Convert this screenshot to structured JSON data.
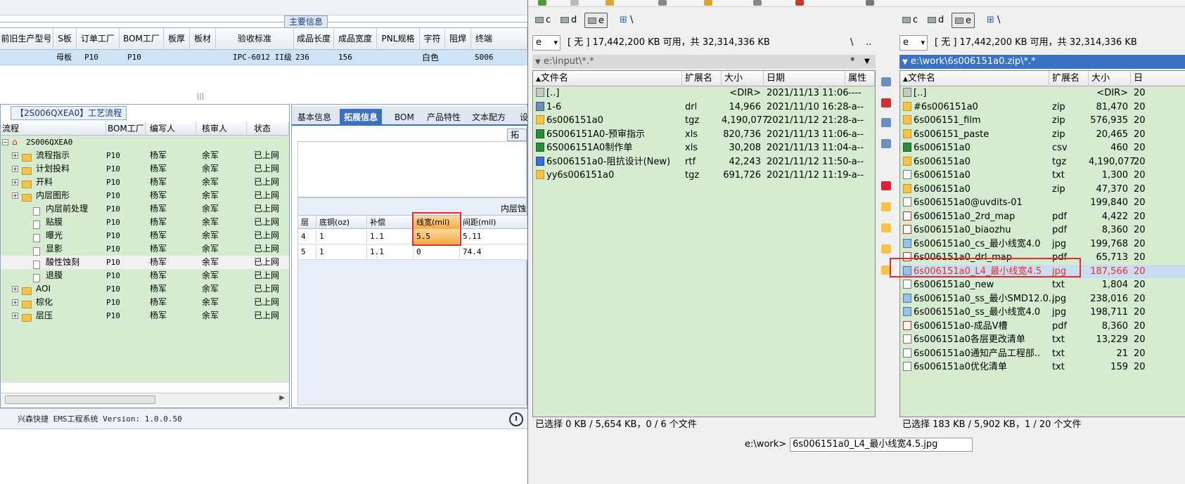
{
  "erp": {
    "main_info_title": "主要信息",
    "top_grid": {
      "columns": [
        "前旧生产型号",
        "S板",
        "订单工厂",
        "BOM工厂",
        "板厚",
        "板材",
        "验收标准",
        "成品长度",
        "成品宽度",
        "PNL规格",
        "字符",
        "阻焊",
        "终端"
      ],
      "row": [
        "",
        "母板",
        "P10",
        "P10",
        "",
        "",
        "IPC-6012 II级",
        "236",
        "156",
        "",
        "白色",
        "",
        "S006"
      ]
    },
    "splitter_grip": "|||",
    "tree": {
      "caption": "【2S006QXEA0】工艺流程",
      "columns": [
        "流程",
        "BOM工厂",
        "编写人",
        "核审人",
        "状态"
      ],
      "root": "2S006QXEA0",
      "rows": [
        {
          "name": "流程指示",
          "factory": "P10",
          "writer": "杨军",
          "reviewer": "余军",
          "status": "已上网",
          "level": 1,
          "type": "folder"
        },
        {
          "name": "计划投料",
          "factory": "P10",
          "writer": "杨军",
          "reviewer": "余军",
          "status": "已上网",
          "level": 1,
          "type": "folder"
        },
        {
          "name": "开料",
          "factory": "P10",
          "writer": "杨军",
          "reviewer": "余军",
          "status": "已上网",
          "level": 1,
          "type": "folder"
        },
        {
          "name": "内层图形",
          "factory": "P10",
          "writer": "杨军",
          "reviewer": "余军",
          "status": "已上网",
          "level": 1,
          "type": "folder"
        },
        {
          "name": "内层前处理",
          "factory": "P10",
          "writer": "杨军",
          "reviewer": "余军",
          "status": "已上网",
          "level": 2,
          "type": "file"
        },
        {
          "name": "贴膜",
          "factory": "P10",
          "writer": "杨军",
          "reviewer": "余军",
          "status": "已上网",
          "level": 2,
          "type": "file"
        },
        {
          "name": "曝光",
          "factory": "P10",
          "writer": "杨军",
          "reviewer": "余军",
          "status": "已上网",
          "level": 2,
          "type": "file"
        },
        {
          "name": "显影",
          "factory": "P10",
          "writer": "杨军",
          "reviewer": "余军",
          "status": "已上网",
          "level": 2,
          "type": "file"
        },
        {
          "name": "酸性蚀刻",
          "factory": "P10",
          "writer": "杨军",
          "reviewer": "余军",
          "status": "已上网",
          "level": 2,
          "type": "file"
        },
        {
          "name": "退膜",
          "factory": "P10",
          "writer": "杨军",
          "reviewer": "余军",
          "status": "已上网",
          "level": 2,
          "type": "file"
        },
        {
          "name": "AOI",
          "factory": "P10",
          "writer": "杨军",
          "reviewer": "余军",
          "status": "已上网",
          "level": 1,
          "type": "folder"
        },
        {
          "name": "棕化",
          "factory": "P10",
          "writer": "杨军",
          "reviewer": "余军",
          "status": "已上网",
          "level": 1,
          "type": "folder"
        },
        {
          "name": "层压",
          "factory": "P10",
          "writer": "杨军",
          "reviewer": "余军",
          "status": "已上网",
          "level": 1,
          "type": "folder"
        }
      ]
    },
    "detail": {
      "tabs": [
        "基本信息",
        "拓展信息",
        "BOM",
        "产品特性",
        "文本配方",
        "设"
      ],
      "active_tab": 1,
      "ext_button": "拓",
      "layer_title": "内层蚀",
      "layer_columns": [
        "层",
        "底铜(oz)",
        "补偿",
        "线宽(mil)",
        "间距(mil)"
      ],
      "layer_rows": [
        [
          "4",
          "1",
          "1.1",
          "5.5",
          "5.11"
        ],
        [
          "5",
          "1",
          "1.1",
          "0",
          "74.4"
        ]
      ]
    },
    "status_text": "兴森快捷 EMS工程系统 Version: 1.0.0.50"
  },
  "tc": {
    "left": {
      "drives": [
        "c",
        "d",
        "e"
      ],
      "active_drive": "e",
      "extra_button": "\\",
      "drive_select": "e",
      "info": "[ 无 ]  17,442,200 KB 可用，共 32,314,336 KB",
      "info_tail1": "\\",
      "info_tail2": "..",
      "path": "e:\\input\\*.*",
      "path_tail": "*",
      "columns": [
        "文件名",
        "扩展名",
        "大小",
        "日期",
        "属性"
      ],
      "files": [
        {
          "name": "[..]",
          "ext": "",
          "size": "<DIR>",
          "date": "2021/11/13 11:06",
          "attr": "----",
          "icon": "up"
        },
        {
          "name": "1-6",
          "ext": "drl",
          "size": "14,966",
          "date": "2021/11/10 16:28",
          "attr": "-a--",
          "icon": "lnk"
        },
        {
          "name": "6s006151a0",
          "ext": "tgz",
          "size": "4,190,077",
          "date": "2021/11/12 21:28",
          "attr": "-a--",
          "icon": "fold"
        },
        {
          "name": "6S006151A0-预审指示",
          "ext": "xls",
          "size": "820,736",
          "date": "2021/11/13 11:06",
          "attr": "-a--",
          "icon": "xls"
        },
        {
          "name": "6S006151A0制作单",
          "ext": "xls",
          "size": "30,208",
          "date": "2021/11/13 11:04",
          "attr": "-a--",
          "icon": "xls"
        },
        {
          "name": "6s006151a0-阻抗设计(New)",
          "ext": "rtf",
          "size": "42,243",
          "date": "2021/11/12 11:50",
          "attr": "-a--",
          "icon": "doc"
        },
        {
          "name": "yy6s006151a0",
          "ext": "tgz",
          "size": "691,726",
          "date": "2021/11/12 11:19",
          "attr": "-a--",
          "icon": "fold"
        }
      ],
      "status": "已选择 0 KB / 5,654 KB，0 / 6 个文件"
    },
    "right": {
      "drives": [
        "c",
        "d",
        "e"
      ],
      "active_drive": "e",
      "extra_button": "\\",
      "drive_select": "e",
      "info": "[ 无 ]  17,442,200 KB 可用，共 32,314,336 KB",
      "path": "e:\\work\\6s006151a0.zip\\*.*",
      "columns": [
        "文件名",
        "扩展名",
        "大小",
        "日"
      ],
      "files": [
        {
          "name": "[..]",
          "ext": "",
          "size": "<DIR>",
          "date": "20",
          "icon": "up"
        },
        {
          "name": "#6s006151a0",
          "ext": "zip",
          "size": "81,470",
          "date": "20",
          "icon": "fold"
        },
        {
          "name": "6s006151_film",
          "ext": "zip",
          "size": "576,935",
          "date": "20",
          "icon": "fold"
        },
        {
          "name": "6s006151_paste",
          "ext": "zip",
          "size": "20,465",
          "date": "20",
          "icon": "fold"
        },
        {
          "name": "6s006151a0",
          "ext": "csv",
          "size": "460",
          "date": "20",
          "icon": "xls"
        },
        {
          "name": "6s006151a0",
          "ext": "tgz",
          "size": "4,190,077",
          "date": "20",
          "icon": "fold"
        },
        {
          "name": "6s006151a0",
          "ext": "txt",
          "size": "1,300",
          "date": "20",
          "icon": "txt"
        },
        {
          "name": "6s006151a0",
          "ext": "zip",
          "size": "47,370",
          "date": "20",
          "icon": "fold"
        },
        {
          "name": "6s006151a0@uvdits-01",
          "ext": "",
          "size": "199,840",
          "date": "20",
          "icon": "txt"
        },
        {
          "name": "6s006151a0_2rd_map",
          "ext": "pdf",
          "size": "4,422",
          "date": "20",
          "icon": "pdf"
        },
        {
          "name": "6s006151a0_biaozhu",
          "ext": "pdf",
          "size": "8,360",
          "date": "20",
          "icon": "pdf"
        },
        {
          "name": "6s006151a0_cs_最小线宽4.0",
          "ext": "jpg",
          "size": "199,768",
          "date": "20",
          "icon": "img"
        },
        {
          "name": "6s006151a0_drl_map",
          "ext": "pdf",
          "size": "65,713",
          "date": "20",
          "icon": "pdf"
        },
        {
          "name": "6s006151a0_L4_最小线宽4.5",
          "ext": "jpg",
          "size": "187,566",
          "date": "20",
          "icon": "img"
        },
        {
          "name": "6s006151a0_new",
          "ext": "txt",
          "size": "1,804",
          "date": "20",
          "icon": "txt"
        },
        {
          "name": "6s006151a0_ss_最小SMD12.0..",
          "ext": "jpg",
          "size": "238,016",
          "date": "20",
          "icon": "img"
        },
        {
          "name": "6s006151a0_ss_最小线宽4.0",
          "ext": "jpg",
          "size": "198,711",
          "date": "20",
          "icon": "img"
        },
        {
          "name": "6s006151a0-成品V槽",
          "ext": "pdf",
          "size": "8,360",
          "date": "20",
          "icon": "pdf"
        },
        {
          "name": "6s006151a0各层更改清单",
          "ext": "txt",
          "size": "13,229",
          "date": "20",
          "icon": "txt"
        },
        {
          "name": "6s006151a0通知产品工程部..",
          "ext": "txt",
          "size": "21",
          "date": "20",
          "icon": "txt"
        },
        {
          "name": "6s006151a0优化清单",
          "ext": "txt",
          "size": "159",
          "date": "20",
          "icon": "txt"
        }
      ],
      "selected_index": 13,
      "status": "已选择 183 KB / 5,902 KB，1 / 20 个文件"
    },
    "cmd_prompt": "e:\\work>",
    "cmd_value": "6s006151a0_L4_最小线宽4.5.jpg"
  },
  "colors": {
    "accent": "#3a72c4",
    "panel_green": "#d5ecd1",
    "highlight_red": "#e0302a",
    "row_select": "#c9dcf2"
  }
}
